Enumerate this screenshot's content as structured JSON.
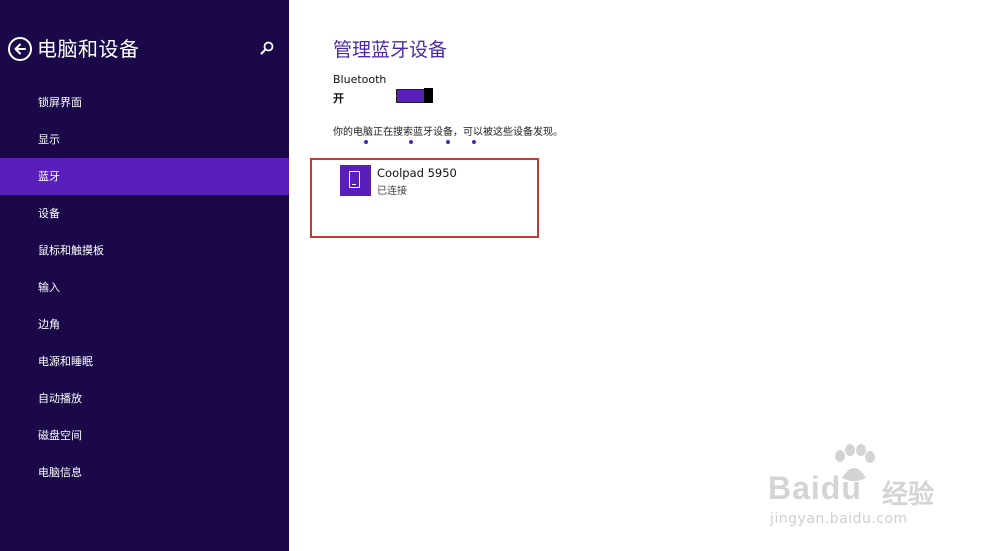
{
  "sidebar": {
    "title": "电脑和设备",
    "items": [
      {
        "label": "锁屏界面"
      },
      {
        "label": "显示"
      },
      {
        "label": "蓝牙"
      },
      {
        "label": "设备"
      },
      {
        "label": "鼠标和触摸板"
      },
      {
        "label": "输入"
      },
      {
        "label": "边角"
      },
      {
        "label": "电源和睡眠"
      },
      {
        "label": "自动播放"
      },
      {
        "label": "磁盘空间"
      },
      {
        "label": "电脑信息"
      }
    ],
    "active_index": 2
  },
  "main": {
    "title": "管理蓝牙设备",
    "bluetooth_label": "Bluetooth",
    "bluetooth_state": "开",
    "searching_text": "你的电脑正在搜索蓝牙设备，可以被这些设备发现。",
    "device": {
      "name": "Coolpad 5950",
      "status": "已连接",
      "icon": "phone-icon"
    }
  },
  "watermark": {
    "brand": "Baidu",
    "cn": "经验",
    "url": "jingyan.baidu.com"
  },
  "colors": {
    "sidebar_bg": "#1a0848",
    "accent": "#5a1fba",
    "title": "#4a2aa6",
    "highlight_border": "#c0393b"
  }
}
